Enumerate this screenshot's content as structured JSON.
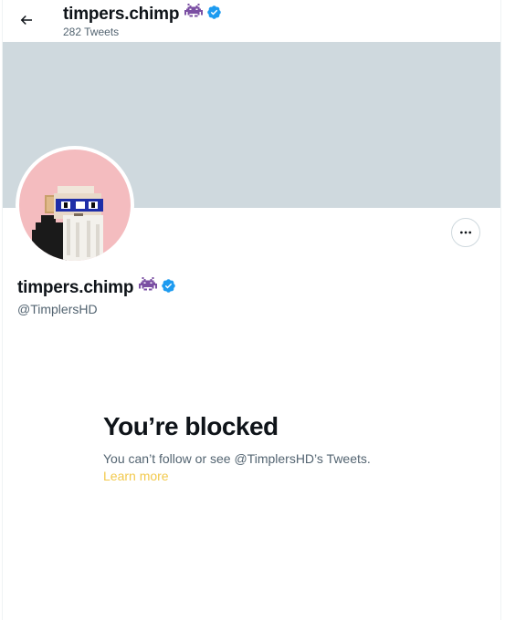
{
  "header": {
    "back_icon": "arrow-left-icon",
    "title": "timpers.chimp",
    "tweet_count": "282 Tweets"
  },
  "profile": {
    "display_name": "timpers.chimp",
    "handle": "@TimplersHD",
    "name_emoji": "space-invader-icon",
    "verified_icon": "verified-badge-icon",
    "more_icon": "more-horizontal-icon",
    "avatar": "pixel-chimp-avatar"
  },
  "blocked": {
    "title": "You’re blocked",
    "description": "You can’t follow or see @TimplersHD’s Tweets.",
    "link_label": "Learn more"
  },
  "colors": {
    "banner": "#cfd9de",
    "avatar_bg": "#f4bcbf",
    "verified": "#1d9bf0",
    "invader": "#7b4fa3",
    "link": "#f2c94c",
    "secondary_text": "#536471"
  }
}
